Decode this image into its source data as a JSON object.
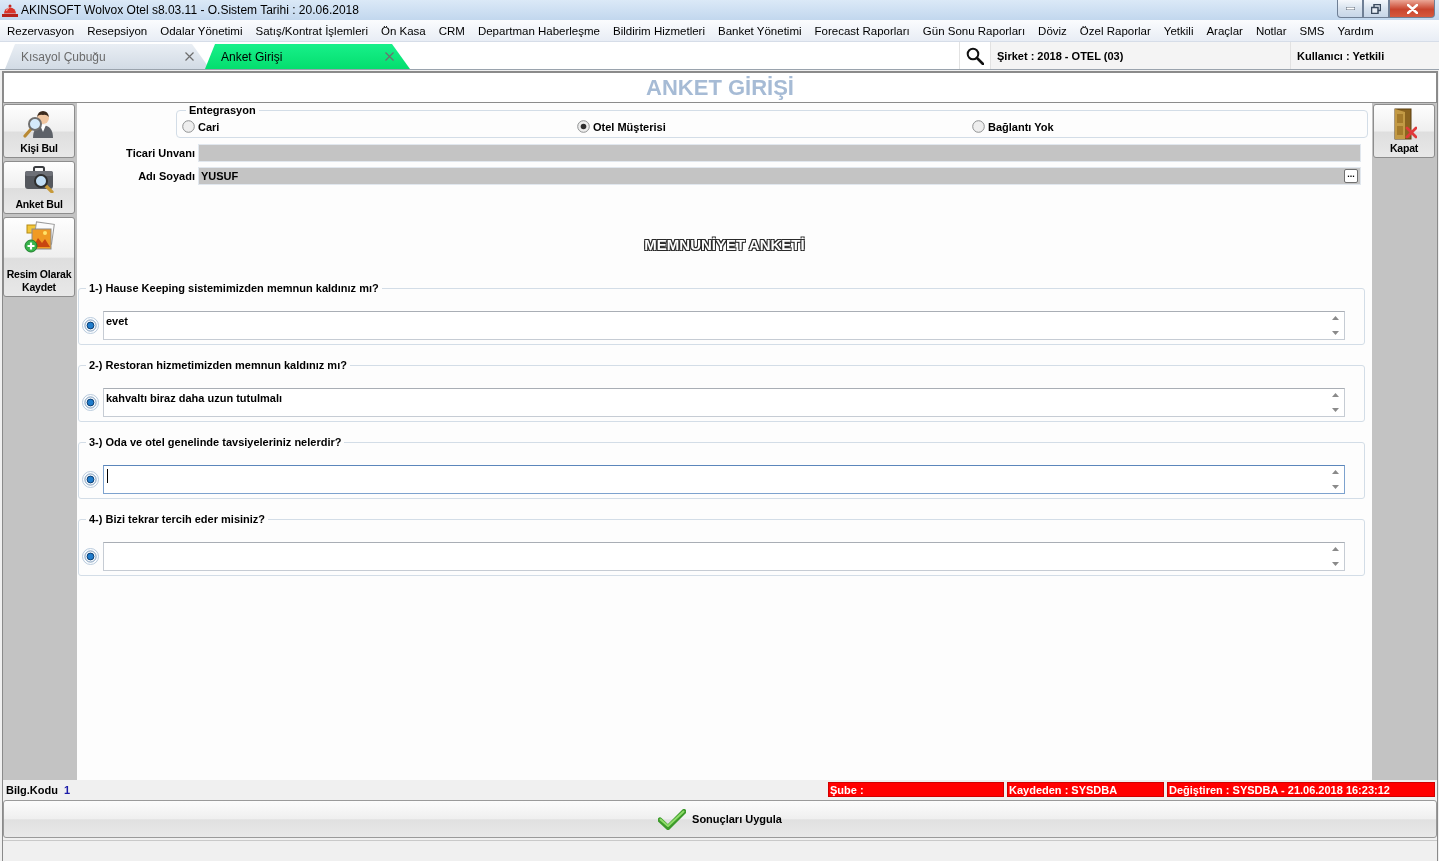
{
  "window": {
    "title": "AKINSOFT Wolvox Otel s8.03.11 - O.Sistem Tarihi : 20.06.2018"
  },
  "menu": [
    "Rezervasyon",
    "Resepsiyon",
    "Odalar Yönetimi",
    "Satış/Kontrat İşlemleri",
    "Ön Kasa",
    "CRM",
    "Departman Haberleşme",
    "Bildirim Hizmetleri",
    "Banket Yönetimi",
    "Forecast Raporları",
    "Gün Sonu Raporları",
    "Döviz",
    "Özel Raporlar",
    "Yetkili",
    "Araçlar",
    "Notlar",
    "SMS",
    "Yardım"
  ],
  "tabs": [
    {
      "label": "Kısayol Çubuğu",
      "selected": false
    },
    {
      "label": "Anket Girişi",
      "selected": true
    }
  ],
  "session": {
    "company": "Şirket : 2018 - OTEL (03)",
    "user": "Kullanıcı : Yetkili"
  },
  "form": {
    "title": "ANKET GİRİŞİ"
  },
  "left_toolbar": [
    {
      "label": "Kişi Bul",
      "kind": "person"
    },
    {
      "label": "Anket Bul",
      "kind": "case"
    },
    {
      "label": "Resim Olarak Kaydet",
      "kind": "image"
    }
  ],
  "right_toolbar": [
    {
      "label": "Kapat",
      "kind": "door"
    }
  ],
  "integration": {
    "legend": "Entegrasyon",
    "options": [
      {
        "label": "Cari",
        "selected": false
      },
      {
        "label": "Otel Müşterisi",
        "selected": true
      },
      {
        "label": "Bağlantı Yok",
        "selected": false
      }
    ]
  },
  "fields": [
    {
      "label": "Ticari Unvanı"
    },
    {
      "label": "Adı Soyadı",
      "value": "YUSUF",
      "button": "..."
    }
  ],
  "survey": {
    "title": "MEMNUNİYET ANKETİ",
    "questions": [
      {
        "question": "1-) Hause Keeping sistemimizden memnun kaldınız mı?",
        "answer": "evet",
        "checked": true,
        "focused": false
      },
      {
        "question": "2-) Restoran hizmetimizden memnun kaldınız mı?",
        "answer": "kahvaltı biraz daha uzun tutulmalı",
        "checked": true,
        "focused": false
      },
      {
        "question": "3-) Oda ve otel genelinde tavsiyeleriniz nelerdir?",
        "checked": true,
        "focused": true
      },
      {
        "question": "4-) Bizi tekrar tercih eder misiniz?",
        "checked": true,
        "focused": false
      }
    ]
  },
  "status_bar": {
    "code_label": "Bilg.Kodu",
    "code_value": "1",
    "cells": [
      "Şube :",
      "Kaydeden : SYSDBA",
      "Değiştiren : SYSDBA - 21.06.2018 16:23:12"
    ]
  },
  "apply_button": {
    "label": "Sonuçları Uygula"
  }
}
